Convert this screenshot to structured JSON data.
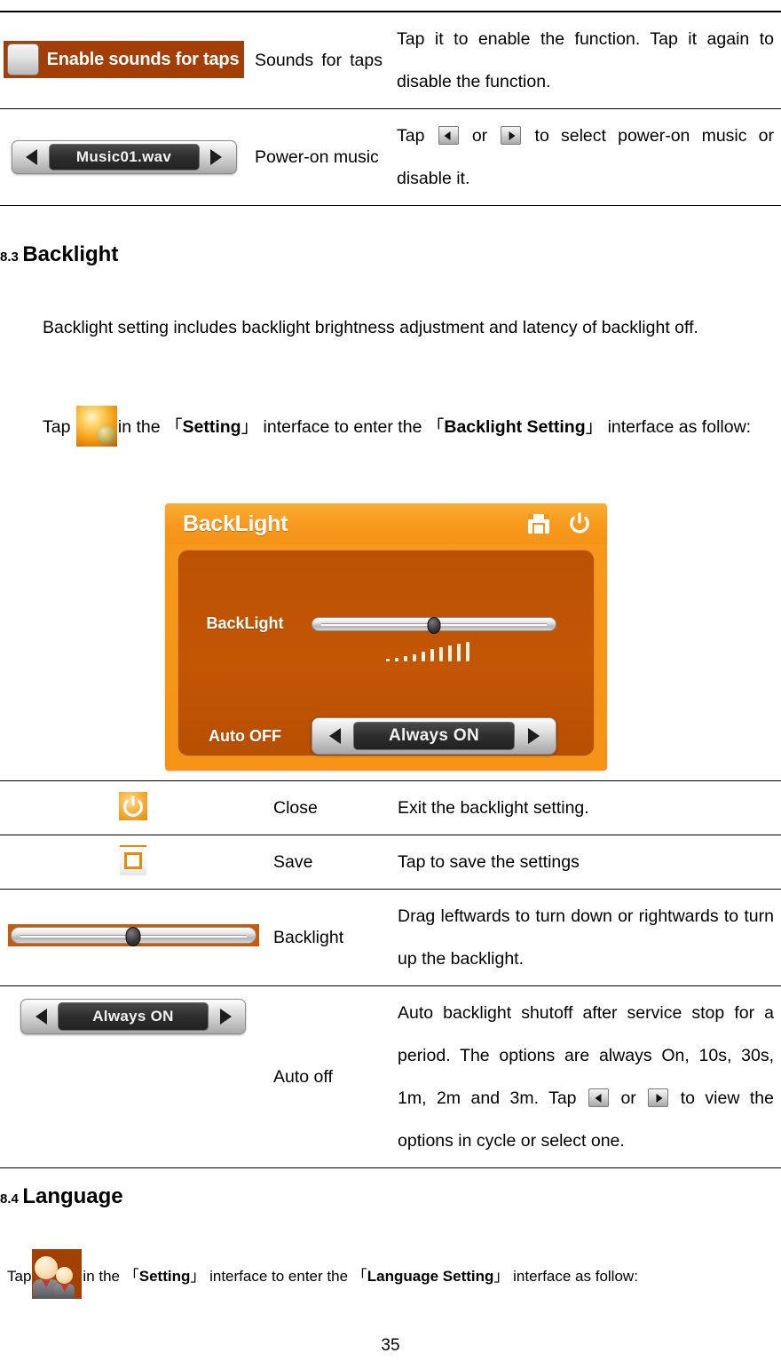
{
  "page": {
    "number": "35"
  },
  "sound_table": {
    "rows": [
      {
        "widget": {
          "type": "checkbox-label",
          "label": "Enable sounds for taps",
          "checked": false,
          "bg_color": "#a23e06"
        },
        "name": "Sounds for taps",
        "description": "Tap it to enable the function. Tap it again to disable the function."
      },
      {
        "widget": {
          "type": "spinner",
          "value": "Music01.wav"
        },
        "name": "Power-on music",
        "desc_prefix": "Tap",
        "desc_mid": "or",
        "desc_suffix": "to select power-on music or disable it."
      }
    ]
  },
  "section_backlight": {
    "number": "8.3",
    "title": "Backlight",
    "paragraph1": "Backlight setting includes backlight brightness adjustment and latency of backlight off.",
    "para2_prefix": "Tap",
    "para2_a": "in the",
    "para2_bracket_open_1": "「",
    "para2_setting": "Setting",
    "para2_bracket_close_1": "」",
    "para2_b": "interface to enter the",
    "para2_bracket_open_2": "「",
    "para2_target": "Backlight Setting",
    "para2_bracket_close_2": "」",
    "para2_c": "interface as follow:",
    "icon_name": "settings-sphere-icon"
  },
  "screenshot": {
    "title": "BackLight",
    "save_icon": "floppy-save-icon",
    "power_icon": "power-close-icon",
    "backlight_label": "BackLight",
    "autooff_label": "Auto OFF",
    "autooff_value": "Always ON",
    "slider_percent": 50,
    "tick_count": 10,
    "frame_color": "#f59417",
    "panel_color": "#c35603"
  },
  "backlight_table": {
    "rows": [
      {
        "widget": {
          "type": "icon",
          "icon": "power-close-icon"
        },
        "name": "Close",
        "description": "Exit the backlight setting."
      },
      {
        "widget": {
          "type": "icon",
          "icon": "floppy-save-icon"
        },
        "name": "Save",
        "description": "Tap to save the settings"
      },
      {
        "widget": {
          "type": "slider",
          "percent": 50
        },
        "name": "Backlight",
        "description": "Drag leftwards to turn down or rightwards to turn up the backlight."
      },
      {
        "widget": {
          "type": "spinner",
          "value": "Always ON"
        },
        "name": "Auto off",
        "desc_part1": "Auto backlight shutoff after service stop for a period. The options are always On, 10s, 30s, 1m, 2m and 3m. Tap",
        "desc_mid": "or",
        "desc_part2": "to view the options in cycle or select one.",
        "options": [
          "Always On",
          "10s",
          "30s",
          "1m",
          "2m",
          "3m"
        ]
      }
    ]
  },
  "section_language": {
    "number": "8.4",
    "title": "Language",
    "para_prefix": "Tap",
    "para_a": "in the",
    "bracket_open_1": "「",
    "para_setting": "Setting",
    "bracket_close_1": "」",
    "para_b": "interface to enter the",
    "bracket_open_2": "「",
    "para_target": "Language Setting",
    "bracket_close_2": "」",
    "para_c": "interface as follow:",
    "icon_name": "people-language-icon"
  }
}
